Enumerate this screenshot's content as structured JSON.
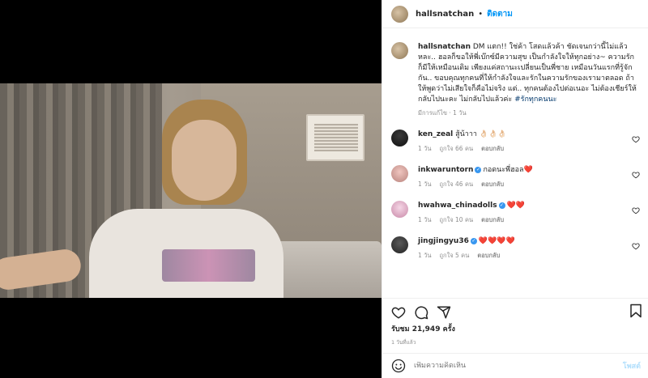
{
  "post": {
    "username": "hallsnatchan",
    "follow_label": "ติดตาม",
    "dot": "•",
    "caption_user": "hallsnatchan",
    "caption_text": " DM แตก!! ใช่ค้า โสดแล้วค้า ชัดเจนกว่านี้ไม่แล้วหละ.. ฮอลก็ขอให้พี่เบ๊กซ์มีความสุข เป็นกำลังใจให้ทุกอย่าง~ ความรักก็มีให้เหมือนเดิม เพียงแค่สถานะเปลี่ยนเป็นพี่ชาย เหมือนวันแรกที่รู้จักกัน.. ขอบคุณทุกคนที่ให้กำลังใจและรักในความรักของเรามาตลอด ถ้าให้พูดว่าไม่เสียใจก็คือไม่จริง แต่.. ทุกคนต้องไปต่อเนอะ ไม่ต้องเชียร์ให้กลับไปนะคะ ไม่กลับไปแล้วค่ะ ",
    "caption_tag": "#รักทุกคนนะ",
    "caption_meta": "มีการแก้ไข · 1 วัน",
    "views": "รับชม 21,949 ครั้ง",
    "time": "1 วันที่แล้ว",
    "add_placeholder": "เพิ่มความคิดเห็น",
    "post_button": "โพสต์"
  },
  "comments": [
    {
      "user": "ken_zeal",
      "verified": false,
      "text": "สู้น้าาา 👌🏻👌🏻👌🏻",
      "age": "1 วัน",
      "likes": "ถูกใจ 66 คน",
      "reply": "ตอบกลับ"
    },
    {
      "user": "inkwaruntorn",
      "verified": true,
      "text": "กอดนะพี่ฮอล❤️",
      "age": "1 วัน",
      "likes": "ถูกใจ 46 คน",
      "reply": "ตอบกลับ"
    },
    {
      "user": "hwahwa_chinadolls",
      "verified": true,
      "text": "❤️❤️",
      "age": "1 วัน",
      "likes": "ถูกใจ 10 คน",
      "reply": "ตอบกลับ"
    },
    {
      "user": "jingjingyu36",
      "verified": true,
      "text": "❤️❤️❤️❤️",
      "age": "1 วัน",
      "likes": "ถูกใจ 5 คน",
      "reply": "ตอบกลับ"
    }
  ],
  "colors": {
    "accent": "#0095f6",
    "muted": "#8e8e8e",
    "heart": "#ed4956",
    "verified": "#3897f0"
  },
  "icons": [
    "heart-icon",
    "comment-icon",
    "share-icon",
    "bookmark-icon",
    "emoji-icon",
    "verified-badge-icon"
  ]
}
